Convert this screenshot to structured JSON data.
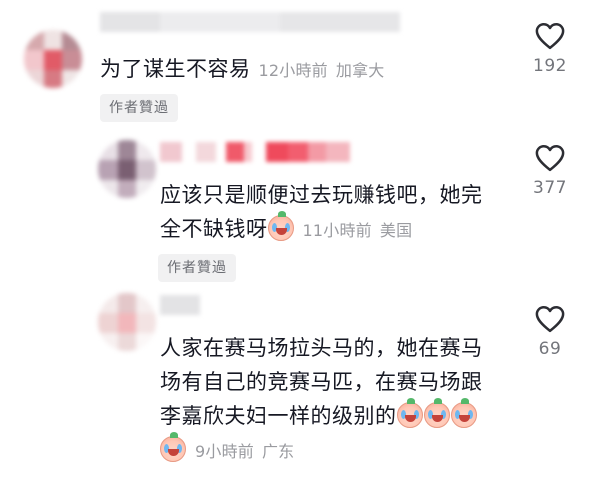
{
  "comments": [
    {
      "text": "为了谋生不容易",
      "time": "12小時前",
      "location": "加拿大",
      "likes": "192",
      "author_liked_label": "作者贊過"
    },
    {
      "text_line1": "应该只是顺便过去玩赚钱吧，她完",
      "text_line2": "全不缺钱呀",
      "time": "11小時前",
      "location": "美国",
      "likes": "377",
      "author_liked_label": "作者贊過"
    },
    {
      "text_line1": "人家在赛马场拉头马的，她在赛马",
      "text_line2": "场有自己的竞赛马匹，在赛马场跟",
      "text_line3": "李嘉欣夫妇一样的级别的",
      "time": "9小時前",
      "location": "广东",
      "likes": "69"
    }
  ],
  "icons": {
    "like": "heart-outline-icon",
    "emoji": "crying-emoji-icon"
  },
  "colors": {
    "text": "#161823",
    "meta": "#9a9ba0",
    "tag_bg": "#f1f1f2",
    "icon": "#2c2d33"
  }
}
